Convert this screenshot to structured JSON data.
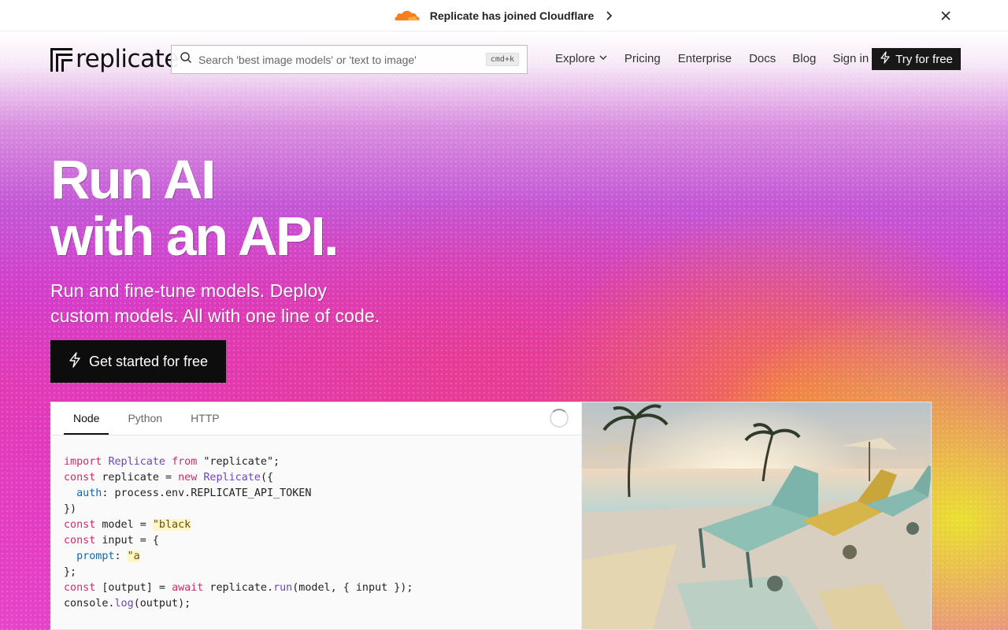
{
  "announcement": {
    "text": "Replicate has joined Cloudflare",
    "logo_icon": "cloudflare-cloud-icon",
    "close_icon": "close-icon"
  },
  "nav": {
    "brand": "replicate",
    "search_placeholder": "Search 'best image models' or 'text to image'",
    "search_shortcut": "cmd+k",
    "links": {
      "explore": "Explore",
      "pricing": "Pricing",
      "enterprise": "Enterprise",
      "docs": "Docs",
      "blog": "Blog",
      "sign_in": "Sign in"
    },
    "try_button": "Try for free"
  },
  "hero": {
    "headline_line1": "Run AI",
    "headline_line2": "with an API.",
    "subtext_line1": "Run and fine-tune models. Deploy",
    "subtext_line2": "custom models. All with one line of code.",
    "cta": "Get started for free"
  },
  "demo": {
    "tabs": [
      "Node",
      "Python",
      "HTTP"
    ],
    "active_tab": "Node",
    "code": {
      "l1": {
        "a": "import",
        "b": " ",
        "c": "Replicate",
        "d": " ",
        "e": "from",
        "f": " \"replicate\";"
      },
      "l2": {
        "a": "const",
        "b": " replicate = ",
        "c": "new",
        "d": " ",
        "e": "Replicate",
        "f": "({"
      },
      "l3": {
        "a": "  ",
        "b": "auth",
        "c": ": process.env.REPLICATE_API_TOKEN"
      },
      "l4": "})",
      "l5": {
        "a": "const",
        "b": " model = ",
        "c": "\"black"
      },
      "l6": {
        "a": "const",
        "b": " input = {"
      },
      "l7": {
        "a": "  ",
        "b": "prompt",
        "c": ": ",
        "d": "\"a"
      },
      "l8": "};",
      "l9": {
        "a": "const",
        "b": " [output] = ",
        "c": "await",
        "d": " replicate.",
        "e": "run",
        "f": "(model, { input });"
      },
      "l10": {
        "a": "console.",
        "b": "log",
        "c": "(output);"
      }
    },
    "image_alt": "Poolside lounge chairs at sunset with palm trees"
  },
  "colors": {
    "accent_dark": "#181818",
    "cloudflare_orange": "#f38020",
    "keyword": "#cf2a6a",
    "class_name": "#6f42c1",
    "property": "#0b6ab0"
  }
}
